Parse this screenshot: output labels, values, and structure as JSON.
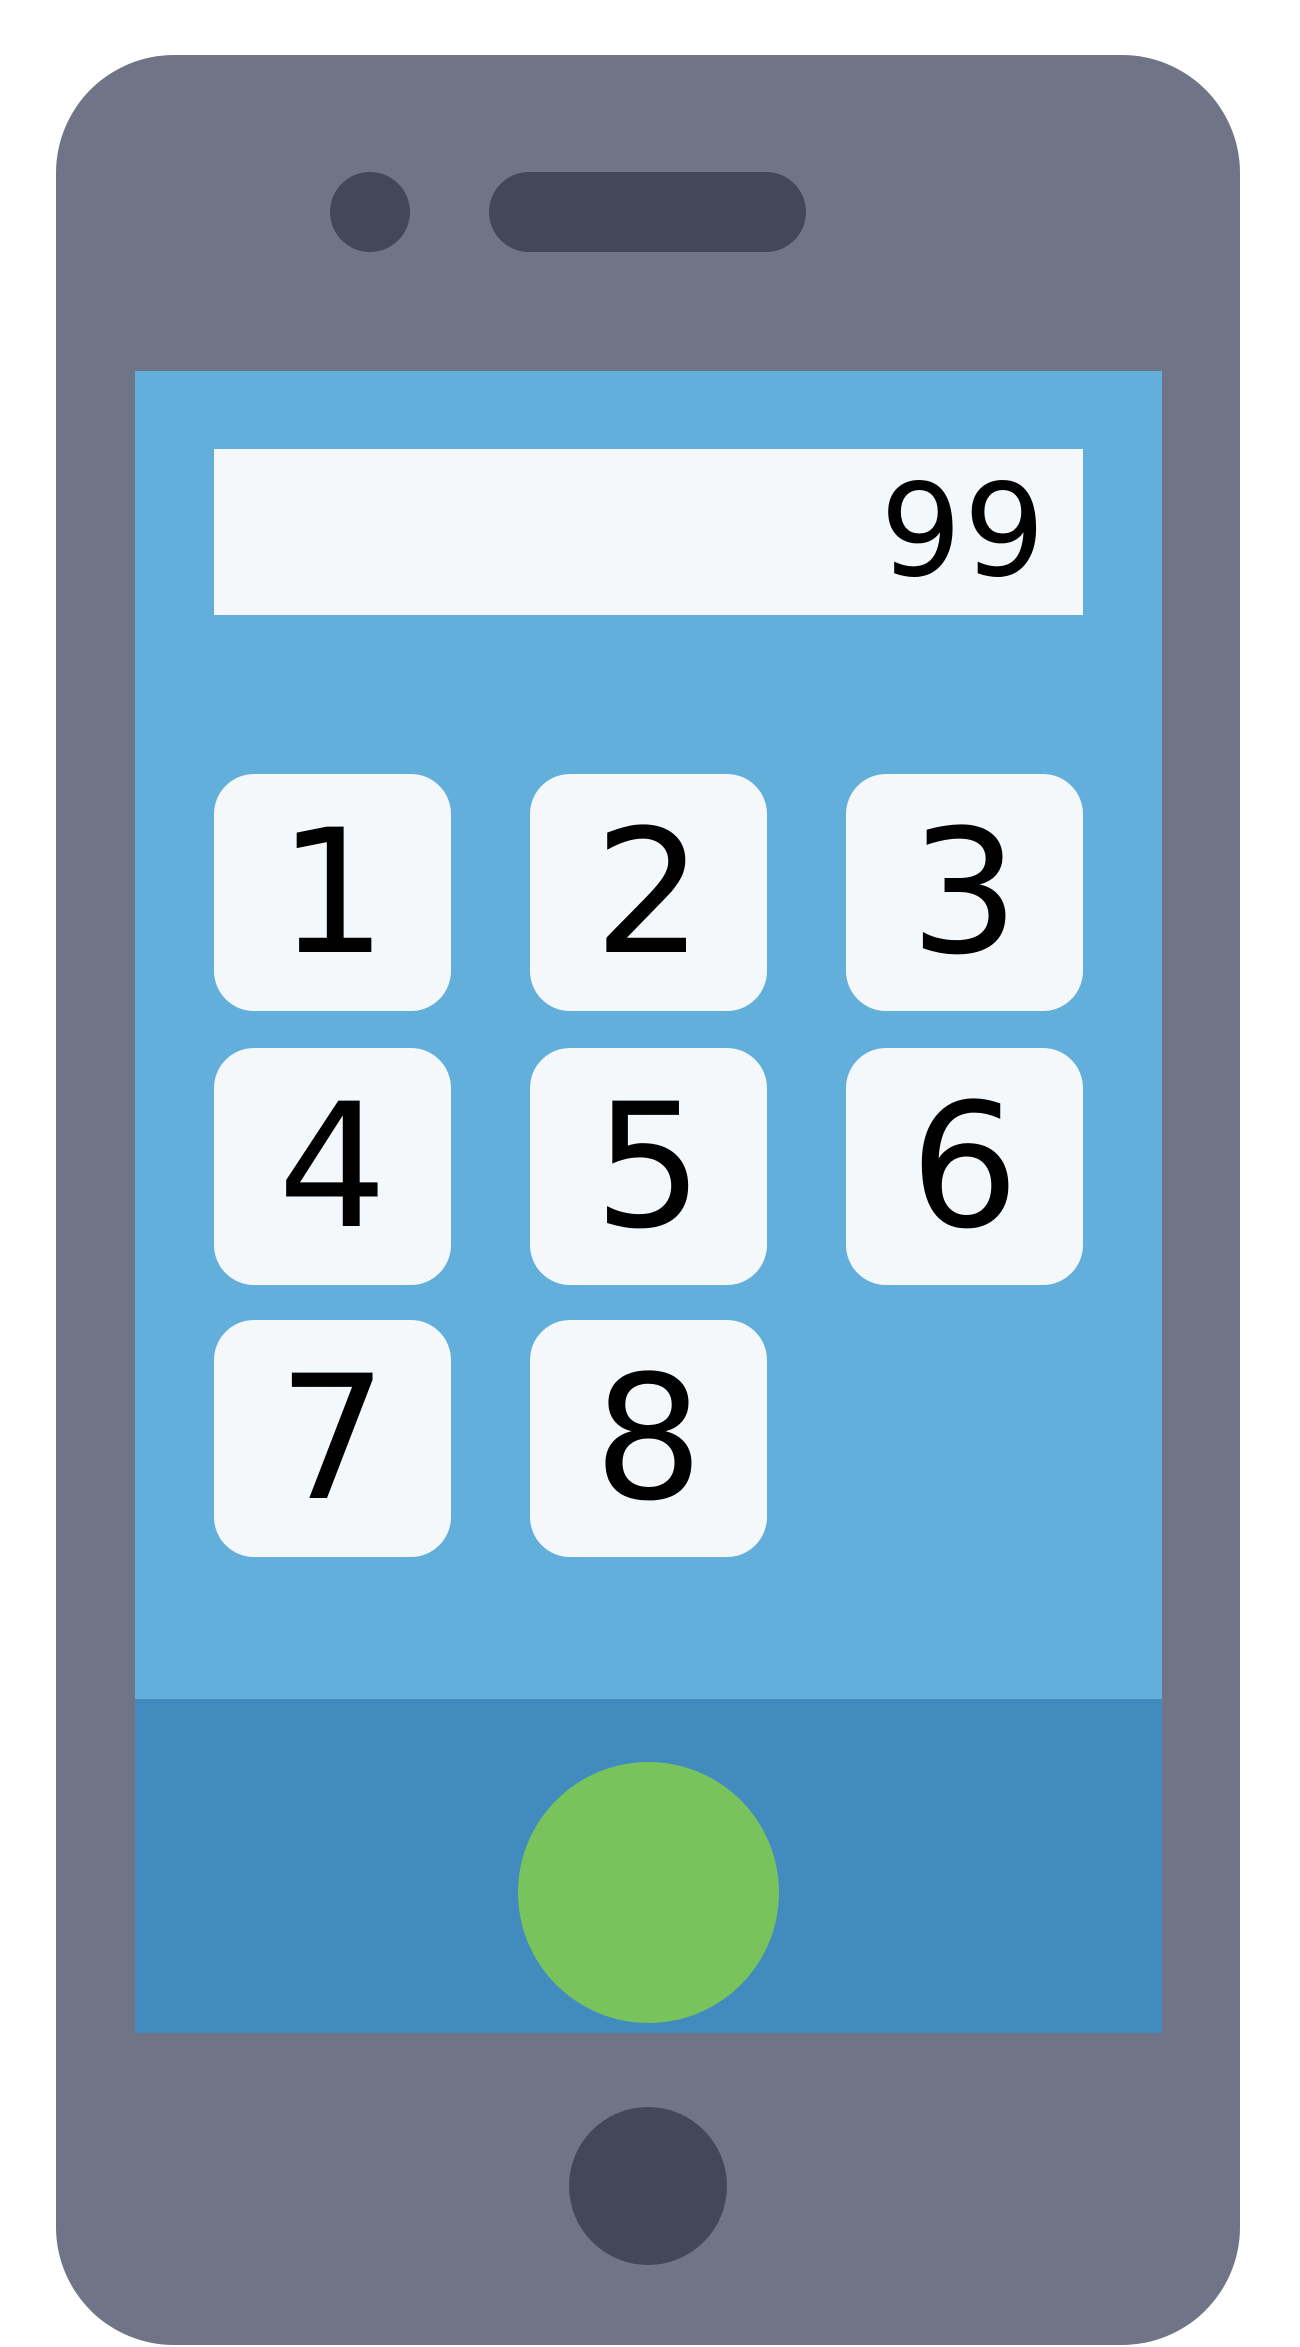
{
  "phone": {
    "body_color": "#707487",
    "screen_color": "#62afdc",
    "bottom_bar_color": "#428bbf",
    "call_button_color": "#79c35d",
    "hardware_color": "#444757"
  },
  "display": {
    "value": "99"
  },
  "keypad": {
    "keys": [
      "1",
      "2",
      "3",
      "4",
      "5",
      "6",
      "7",
      "8"
    ]
  },
  "icons": {
    "call": "call-button-circle",
    "home": "home-button-circle",
    "camera": "front-camera",
    "speaker": "earpiece-speaker"
  }
}
